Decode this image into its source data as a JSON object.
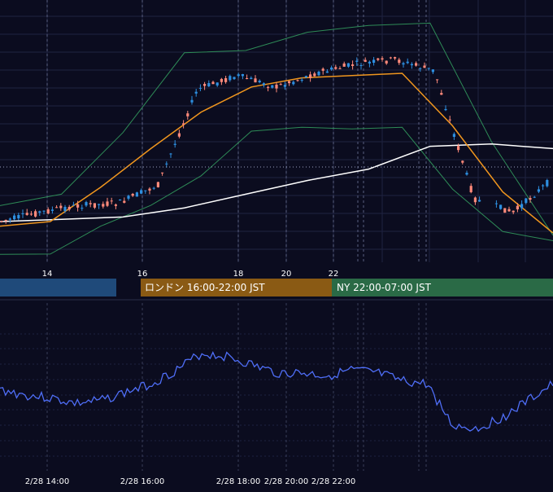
{
  "colors": {
    "background": "#0b0c1f",
    "grid": "#1f2340",
    "up_candle": "#2d8fe0",
    "down_candle": "#ff8a7a",
    "bollinger": "#2e8b57",
    "ma_short": "#f0961e",
    "ma_long": "#ffffff",
    "oscillator": "#4f6ef7",
    "session_tokyo": "#1f4a7a",
    "session_london": "#8a5a14",
    "session_ny": "#2a6a46",
    "axis_text": "#ffffff"
  },
  "sessions": [
    {
      "label": ""
    },
    {
      "label": "ロンドン 16:00-22:00 JST"
    },
    {
      "label": "NY 22:00-07:00 JST"
    }
  ],
  "chart_data": [
    {
      "type": "line",
      "panel": "price",
      "x_axis_labels": [
        "14",
        "16",
        "18",
        "20",
        "22"
      ],
      "series": [
        {
          "role": "candles",
          "values": [
            1.0,
            1.4,
            1.7,
            1.8,
            2.6,
            6.8,
            7.4,
            6.9,
            7.5,
            7.9,
            8.1,
            7.6,
            2.0,
            1.4,
            2.9
          ]
        },
        {
          "role": "ma_short",
          "values": [
            0.8,
            1.0,
            2.5,
            4.2,
            5.8,
            6.9,
            7.3,
            7.4,
            7.5,
            5.2,
            2.3,
            0.5
          ]
        },
        {
          "role": "ma_long",
          "values": [
            1.0,
            1.1,
            1.2,
            1.6,
            2.2,
            2.8,
            3.3,
            4.3,
            4.4,
            4.2
          ]
        },
        {
          "role": "bollinger",
          "values": [
            1.7,
            2.2,
            4.9,
            8.4,
            8.5,
            9.3,
            9.6,
            9.7,
            4.5,
            0.4
          ]
        }
      ]
    },
    {
      "type": "line",
      "panel": "oscillator",
      "x_axis_labels": [
        "2/28 14:00",
        "2/28 16:00",
        "2/28 18:00",
        "2/28 20:00",
        "2/28 22:00"
      ],
      "series": [
        {
          "role": "oscillator",
          "values": [
            48,
            44,
            42,
            38,
            40,
            46,
            52,
            62,
            74,
            72,
            66,
            60,
            60,
            58,
            62,
            60,
            54,
            52,
            22,
            20,
            28,
            40,
            52
          ]
        }
      ]
    }
  ]
}
